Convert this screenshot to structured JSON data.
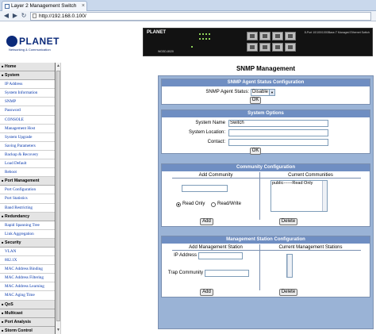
{
  "browser": {
    "tab_title": "Layer 2 Management Switch",
    "close_glyph": "×",
    "back_glyph": "◀",
    "forward_glyph": "▶",
    "refresh_glyph": "↻",
    "address": "http://192.168.0.100/"
  },
  "banner": {
    "logo_text": "PLANET",
    "logo_subtitle": "Networking & Communication",
    "device_brand": "PLANET",
    "device_model": "WGSD-8020",
    "device_description": "8-Port 10/100/1000Base-T Managed Ethernet Switch"
  },
  "sidebar": {
    "items": [
      {
        "label": "Home",
        "group": true
      },
      {
        "label": "System",
        "group": true
      },
      {
        "label": "IP Address",
        "group": false
      },
      {
        "label": "System Information",
        "group": false
      },
      {
        "label": "SNMP",
        "group": false
      },
      {
        "label": "Password",
        "group": false
      },
      {
        "label": "CONSOLE",
        "group": false
      },
      {
        "label": "Management Host",
        "group": false
      },
      {
        "label": "System Upgrade",
        "group": false
      },
      {
        "label": "Saving Parameters",
        "group": false
      },
      {
        "label": "Backup & Recovery",
        "group": false
      },
      {
        "label": "Load Default",
        "group": false
      },
      {
        "label": "Reboot",
        "group": false
      },
      {
        "label": "Port Management",
        "group": true
      },
      {
        "label": "Port Configuration",
        "group": false
      },
      {
        "label": "Port Statistics",
        "group": false
      },
      {
        "label": "Band Restricting",
        "group": false
      },
      {
        "label": "Redundancy",
        "group": true
      },
      {
        "label": "Rapid Spanning Tree",
        "group": false
      },
      {
        "label": "Link Aggregation",
        "group": false
      },
      {
        "label": "Security",
        "group": true
      },
      {
        "label": "VLAN",
        "group": false
      },
      {
        "label": "802.1X",
        "group": false
      },
      {
        "label": "MAC Address Binding",
        "group": false
      },
      {
        "label": "MAC Address Filtering",
        "group": false
      },
      {
        "label": "MAC Address Learning",
        "group": false
      },
      {
        "label": "MAC Aging Time",
        "group": false
      },
      {
        "label": "QoS",
        "group": true
      },
      {
        "label": "Multicast",
        "group": true
      },
      {
        "label": "Port Analysis",
        "group": true
      },
      {
        "label": "Storm Control",
        "group": true
      }
    ]
  },
  "page": {
    "title": "SNMP Management"
  },
  "agent_status": {
    "header": "SNMP Agent Status Configuration",
    "label": "SNMP Agent Status:",
    "value": "Disable",
    "ok_label": "OK"
  },
  "system_options": {
    "header": "System Options",
    "name_label": "System Name",
    "name_value": "Switch",
    "location_label": "System Location:",
    "location_value": "",
    "contact_label": "Contact:",
    "contact_value": "",
    "ok_label": "OK"
  },
  "community": {
    "header": "Community Configuration",
    "add_header": "Add Community",
    "current_header": "Current Communities",
    "community_input": "",
    "read_only_label": "Read Only",
    "read_write_label": "Read/Write",
    "selected_access": "Read Only",
    "current_list": [
      "public------Read Only"
    ],
    "add_label": "Add",
    "delete_label": "Delete"
  },
  "management_station": {
    "header": "Management Station Configuration",
    "add_header": "Add Management Station",
    "current_header": "Current Management Stations",
    "ip_label": "IP Address",
    "ip_value": "",
    "trap_label": "Trap Community",
    "trap_value": "",
    "add_label": "Add",
    "delete_label": "Delete"
  }
}
